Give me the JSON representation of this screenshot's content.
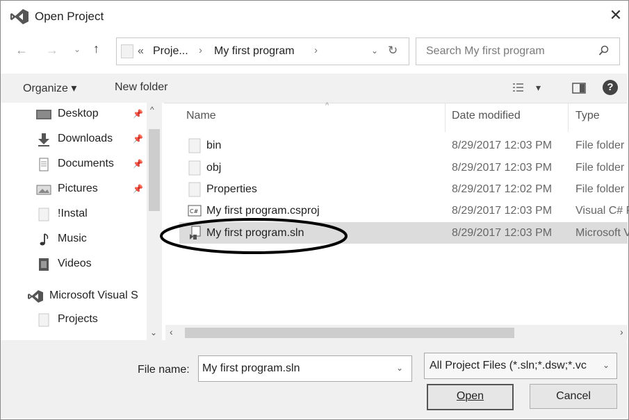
{
  "window": {
    "title": "Open Project",
    "close_symbol": "✕"
  },
  "address_bar": {
    "crumbs": [
      "«",
      "Proje...",
      "My first program"
    ],
    "refresh_symbol": "↻"
  },
  "search": {
    "placeholder": "Search My first program"
  },
  "toolbar": {
    "organize_label": "Organize ▾",
    "new_folder_label": "New folder",
    "view_caret": "▾",
    "help_symbol": "?"
  },
  "sidebar": {
    "items": [
      {
        "label": "Desktop",
        "icon": "desktop-icon",
        "pinned": true
      },
      {
        "label": "Downloads",
        "icon": "download-icon",
        "pinned": true
      },
      {
        "label": "Documents",
        "icon": "document-icon",
        "pinned": true
      },
      {
        "label": "Pictures",
        "icon": "pictures-icon",
        "pinned": true
      },
      {
        "label": "!Instal",
        "icon": "folder-icon",
        "pinned": false
      },
      {
        "label": "Music",
        "icon": "music-icon",
        "pinned": false
      },
      {
        "label": "Videos",
        "icon": "video-icon",
        "pinned": false
      },
      {
        "label": "Microsoft Visual S",
        "icon": "visual-studio-icon",
        "pinned": false
      },
      {
        "label": "Projects",
        "icon": "folder-icon",
        "pinned": false
      }
    ]
  },
  "file_list": {
    "columns": [
      "Name",
      "Date modified",
      "Type"
    ],
    "rows": [
      {
        "name": "bin",
        "date": "8/29/2017 12:03 PM",
        "type": "File folder",
        "icon": "folder-icon",
        "selected": false
      },
      {
        "name": "obj",
        "date": "8/29/2017 12:03 PM",
        "type": "File folder",
        "icon": "folder-icon",
        "selected": false
      },
      {
        "name": "Properties",
        "date": "8/29/2017 12:02 PM",
        "type": "File folder",
        "icon": "folder-icon",
        "selected": false
      },
      {
        "name": "My first program.csproj",
        "date": "8/29/2017 12:03 PM",
        "type": "Visual C# P",
        "icon": "csproj-icon",
        "selected": false
      },
      {
        "name": "My first program.sln",
        "date": "8/29/2017 12:03 PM",
        "type": "Microsoft V",
        "icon": "sln-icon",
        "selected": true
      }
    ]
  },
  "bottom": {
    "file_name_label": "File name:",
    "file_name_value": "My first program.sln",
    "filter_value": "All Project Files (*.sln;*.dsw;*.vc",
    "open_label": "Open",
    "cancel_label": "Cancel"
  },
  "colors": {
    "selection": "#dcdcdc",
    "toolbar": "#f1f1f1",
    "bottom_panel": "#f0f0f0"
  }
}
